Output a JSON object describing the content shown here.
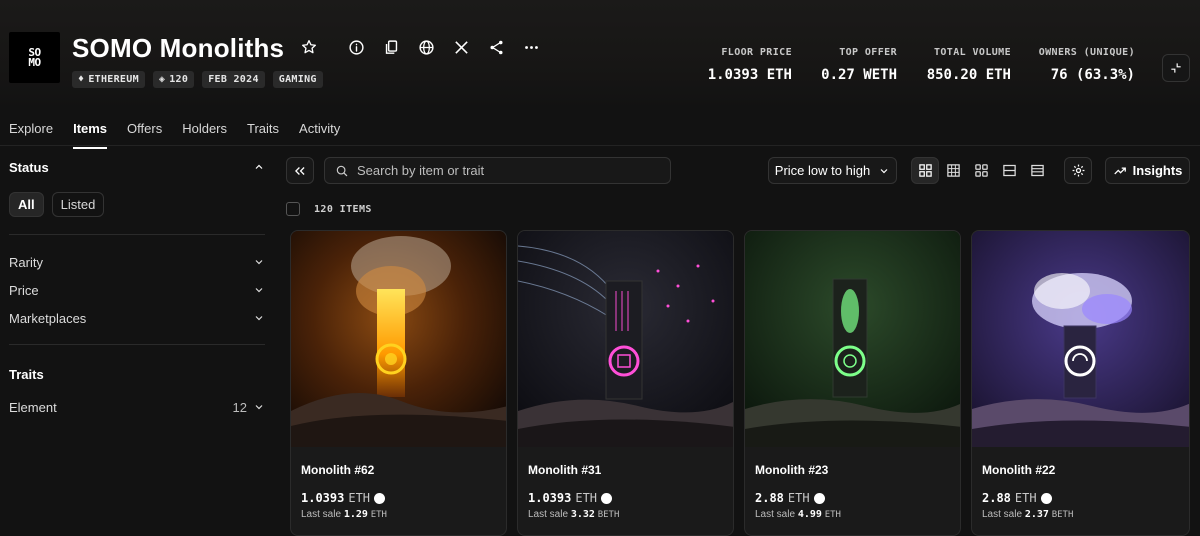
{
  "collection": {
    "logo_text": "SO\nMO",
    "title": "SOMO Monoliths",
    "chips": [
      {
        "icon": "ethereum-icon",
        "label": "ETHEREUM"
      },
      {
        "icon": "stack-icon",
        "label": "120"
      },
      {
        "icon": "",
        "label": "FEB 2024"
      },
      {
        "icon": "",
        "label": "GAMING"
      }
    ],
    "header_icons": [
      "info-icon",
      "copy-icon",
      "globe-icon",
      "x-icon",
      "share-icon",
      "more-icon"
    ]
  },
  "stats": [
    {
      "label": "FLOOR PRICE",
      "value": "1.0393 ETH"
    },
    {
      "label": "TOP OFFER",
      "value": "0.27 WETH"
    },
    {
      "label": "TOTAL VOLUME",
      "value": "850.20 ETH"
    },
    {
      "label": "OWNERS (UNIQUE)",
      "value": "76 (63.3%)"
    }
  ],
  "tabs": [
    "Explore",
    "Items",
    "Offers",
    "Holders",
    "Traits",
    "Activity"
  ],
  "active_tab": "Items",
  "sidebar": {
    "status": {
      "title": "Status",
      "options": [
        "All",
        "Listed"
      ],
      "selected": "All"
    },
    "filters": [
      {
        "label": "Rarity"
      },
      {
        "label": "Price"
      },
      {
        "label": "Marketplaces"
      }
    ],
    "traits": {
      "title": "Traits",
      "items": [
        {
          "label": "Element",
          "count": "12"
        }
      ]
    }
  },
  "toolbar": {
    "search_placeholder": "Search by item or trait",
    "sort": "Price low to high",
    "insights": "Insights",
    "item_count": "120 ITEMS"
  },
  "items": [
    {
      "name": "Monolith #62",
      "price": "1.0393",
      "currency": "ETH",
      "last_sale_label": "Last sale",
      "last_sale": "1.29",
      "last_sale_currency": "ETH",
      "theme": "fire"
    },
    {
      "name": "Monolith #31",
      "price": "1.0393",
      "currency": "ETH",
      "last_sale_label": "Last sale",
      "last_sale": "3.32",
      "last_sale_currency": "BETH",
      "theme": "tech"
    },
    {
      "name": "Monolith #23",
      "price": "2.88",
      "currency": "ETH",
      "last_sale_label": "Last sale",
      "last_sale": "4.99",
      "last_sale_currency": "ETH",
      "theme": "nature"
    },
    {
      "name": "Monolith #22",
      "price": "2.88",
      "currency": "ETH",
      "last_sale_label": "Last sale",
      "last_sale": "2.37",
      "last_sale_currency": "BETH",
      "theme": "wind"
    }
  ],
  "colors": {
    "background": "#121212",
    "fire": "#ffb000",
    "tech": "#ff4fd8",
    "nature": "#7dff8a",
    "wind": "#b9a8ff"
  }
}
